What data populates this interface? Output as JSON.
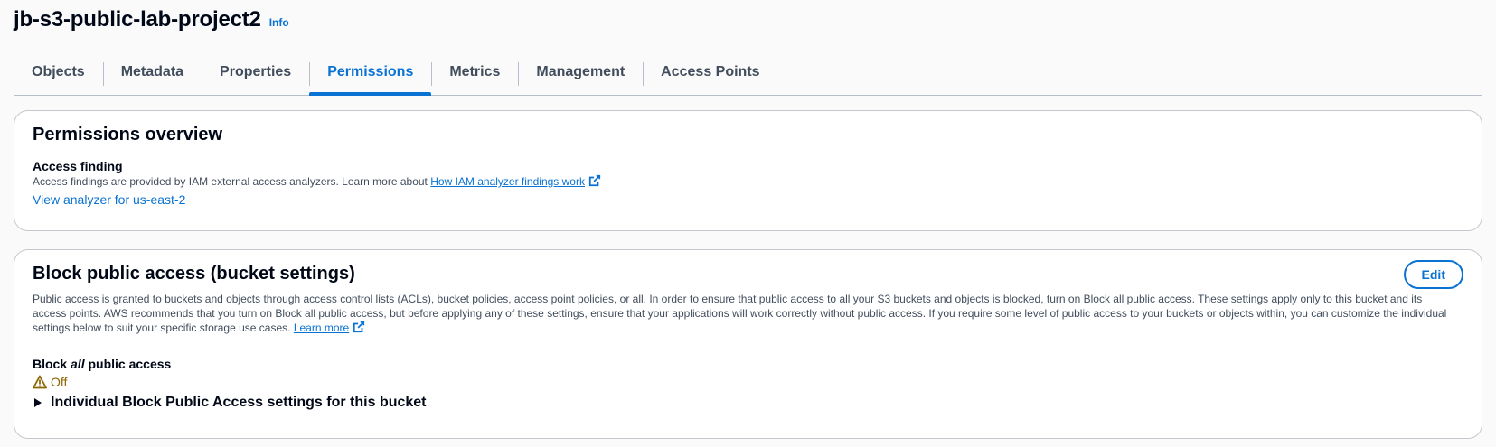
{
  "header": {
    "bucket_name": "jb-s3-public-lab-project2",
    "info_label": "Info"
  },
  "tabs": [
    {
      "label": "Objects",
      "active": false
    },
    {
      "label": "Metadata",
      "active": false
    },
    {
      "label": "Properties",
      "active": false
    },
    {
      "label": "Permissions",
      "active": true
    },
    {
      "label": "Metrics",
      "active": false
    },
    {
      "label": "Management",
      "active": false
    },
    {
      "label": "Access Points",
      "active": false
    }
  ],
  "overview": {
    "title": "Permissions overview",
    "access_finding_heading": "Access finding",
    "access_finding_text": "Access findings are provided by IAM external access analyzers. Learn more about",
    "analyzer_link": "How IAM analyzer findings work",
    "view_analyzer_link": "View analyzer for us-east-2"
  },
  "block_public_access": {
    "title": "Block public access (bucket settings)",
    "edit_label": "Edit",
    "description": "Public access is granted to buckets and objects through access control lists (ACLs), bucket policies, access point policies, or all. In order to ensure that public access to all your S3 buckets and objects is blocked, turn on Block all public access. These settings apply only to this bucket and its access points. AWS recommends that you turn on Block all public access, but before applying any of these settings, ensure that your applications will work correctly without public access. If you require some level of public access to your buckets or objects within, you can customize the individual settings below to suit your specific storage use cases.",
    "learn_more_link": "Learn more",
    "block_all_prefix": "Block",
    "block_all_em": "all",
    "block_all_suffix": "public access",
    "status": "Off",
    "expander_label": "Individual Block Public Access settings for this bucket"
  },
  "colors": {
    "link": "#0972d3",
    "warning": "#8d6605",
    "text": "#000716"
  }
}
